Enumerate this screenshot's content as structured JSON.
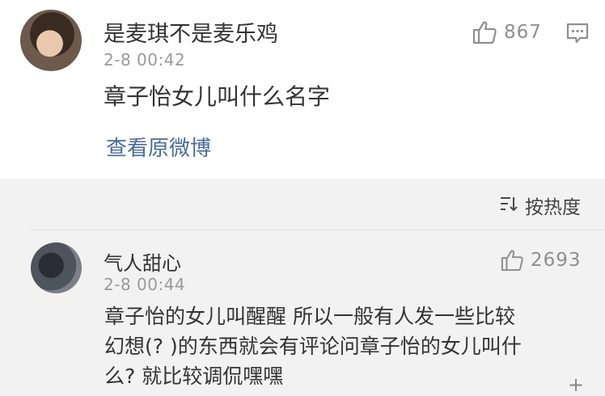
{
  "post": {
    "username": "是麦琪不是麦乐鸡",
    "time": "2-8 00:42",
    "text": "章子怡女儿叫什么名字",
    "view_original": "查看原微博",
    "like_count": "867"
  },
  "sort": {
    "label": "按热度"
  },
  "comment": {
    "username": "气人甜心",
    "time": "2-8 00:44",
    "like_count": "2693",
    "lines": [
      "章子怡的女儿叫醒醒 所以一般有人发一些比较",
      "幻想(? )的东西就会有评论问章子怡的女儿叫什",
      "么? 就比较调侃嘿嘿"
    ]
  },
  "icons": {
    "like": "thumbs-up-icon",
    "comment": "comment-icon",
    "sort": "sort-icon"
  }
}
